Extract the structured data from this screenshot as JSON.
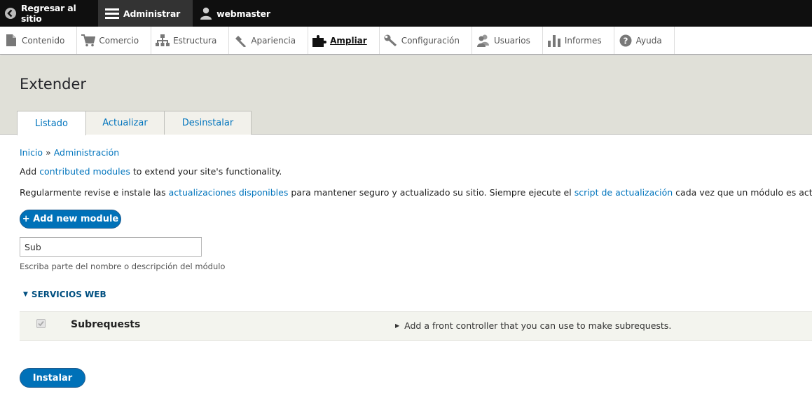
{
  "toolbar": {
    "back_label": "Regresar al sitio",
    "admin_label": "Administrar",
    "user_label": "webmaster"
  },
  "menu": [
    {
      "label": "Contenido",
      "icon": "file-icon"
    },
    {
      "label": "Comercio",
      "icon": "cart-icon"
    },
    {
      "label": "Estructura",
      "icon": "sitemap-icon"
    },
    {
      "label": "Apariencia",
      "icon": "paintbrush-icon"
    },
    {
      "label": "Ampliar",
      "icon": "puzzle-icon",
      "active": true
    },
    {
      "label": "Configuración",
      "icon": "wrench-icon"
    },
    {
      "label": "Usuarios",
      "icon": "people-icon"
    },
    {
      "label": "Informes",
      "icon": "bar-chart-icon"
    },
    {
      "label": "Ayuda",
      "icon": "help-icon"
    }
  ],
  "page": {
    "title": "Extender",
    "tabs": [
      "Listado",
      "Actualizar",
      "Desinstalar"
    ],
    "active_tab": "Listado"
  },
  "breadcrumb": {
    "home": "Inicio",
    "separator": "»",
    "admin": "Administración"
  },
  "intro": {
    "prefix": "Add ",
    "link": "contributed modules",
    "suffix": " to extend your site's functionality."
  },
  "updates": {
    "prefix": "Regularmente revise e instale las ",
    "link1": "actualizaciones disponibles",
    "middle": " para mantener seguro y actualizado su sitio. Siempre ejecute el ",
    "link2": "script de actualización",
    "suffix": " cada vez que un módulo es act"
  },
  "add_module_label": "+ Add new module",
  "filter": {
    "value": "Sub",
    "description": "Escriba parte del nombre o descripción del módulo"
  },
  "package": {
    "title": "SERVICIOS WEB",
    "modules": [
      {
        "name": "Subrequests",
        "description": "Add a front controller that you can use to make subrequests.",
        "checked": true,
        "disabled": true
      }
    ]
  },
  "install_label": "Instalar",
  "colors": {
    "link": "#0074bd",
    "button": "#0071b8",
    "header_bg": "#e0e0d8",
    "toolbar_bg": "#0f0f0f"
  }
}
